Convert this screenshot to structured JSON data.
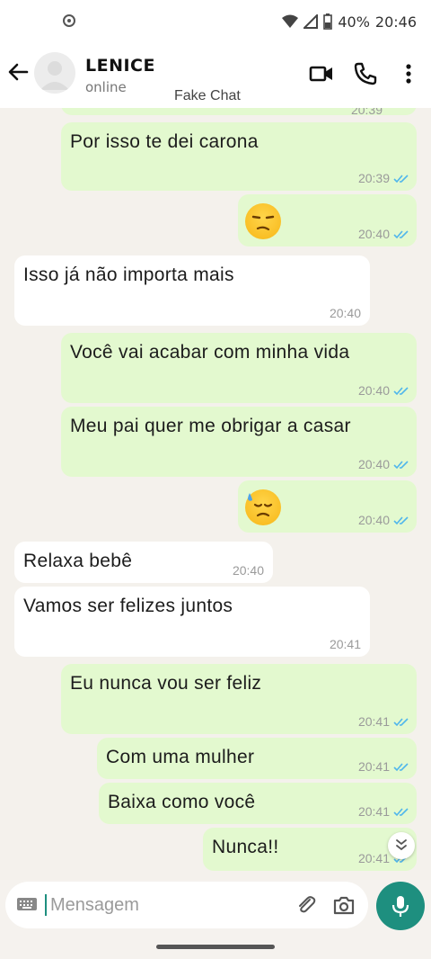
{
  "status_bar": {
    "battery": "40%",
    "time": "20:46"
  },
  "header": {
    "contact_name": "LENICE",
    "contact_status": "online",
    "watermark": "Fake Chat"
  },
  "messages": [
    {
      "dir": "out",
      "text": "Por isso te dei carona",
      "time": "20:39"
    },
    {
      "dir": "out",
      "emoji": "unamused-face",
      "time": "20:40"
    },
    {
      "dir": "in",
      "text": "Isso já não importa mais",
      "time": "20:40"
    },
    {
      "dir": "out",
      "text": "Você vai acabar com minha vida",
      "time": "20:40"
    },
    {
      "dir": "out",
      "text": "Meu pai quer me obrigar a casar",
      "time": "20:40"
    },
    {
      "dir": "out",
      "emoji": "downcast-sweat-face",
      "time": "20:40"
    },
    {
      "dir": "in",
      "text": "Relaxa bebê",
      "time": "20:40"
    },
    {
      "dir": "in",
      "text": "Vamos ser felizes juntos",
      "time": "20:41"
    },
    {
      "dir": "out",
      "text": "Eu nunca vou ser feliz",
      "time": "20:41"
    },
    {
      "dir": "out",
      "text": "Com uma mulher",
      "time": "20:41"
    },
    {
      "dir": "out",
      "text": "Baixa como você",
      "time": "20:41"
    },
    {
      "dir": "out",
      "text": "Nunca!!",
      "time": "20:41"
    }
  ],
  "partial_top": {
    "time": "20:39"
  },
  "composer": {
    "placeholder": "Mensagem"
  },
  "colors": {
    "outgoing": "#e3f9cf",
    "incoming": "#ffffff",
    "accent": "#1e8f7f",
    "tick": "#4fb6ec"
  }
}
